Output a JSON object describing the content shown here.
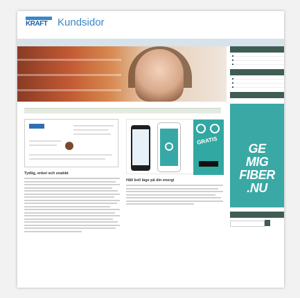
{
  "header": {
    "logo_top": "",
    "logo_bottom": "KRAFT",
    "title": "Kundsidor"
  },
  "nav": {
    "items": [
      "",
      "",
      "",
      "",
      "",
      ""
    ],
    "right": ""
  },
  "welcome": {
    "label": ""
  },
  "left_article": {
    "heading": "Tydlig, enkel och snabbt"
  },
  "mid_article": {
    "heading": "Håll koll läge på din energi",
    "gratis": "GRATIS",
    "link": ""
  },
  "sidebar": {
    "box1_title": "",
    "box1_items": [
      "",
      "",
      ""
    ],
    "box2_title": "",
    "box2_items": [
      "",
      "",
      ""
    ],
    "box3_title": "",
    "fiber_lines": [
      "GE",
      "MIG",
      "FIBER",
      ".NU"
    ],
    "search_title": ""
  },
  "colors": {
    "accent": "#3a86c8",
    "teal": "#32a8a3",
    "dark": "#3f5c55"
  }
}
